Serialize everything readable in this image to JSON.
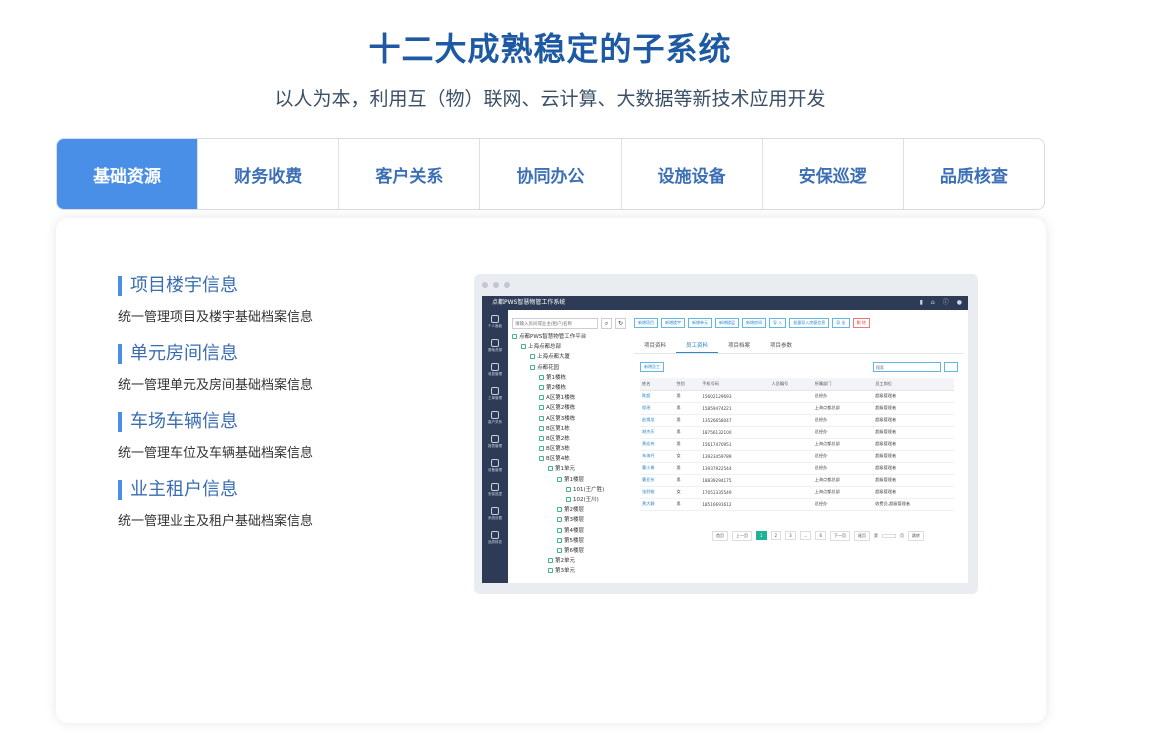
{
  "header": {
    "title": "十二大成熟稳定的子系统",
    "subtitle": "以人为本，利用互（物）联网、云计算、大数据等新技术应用开发"
  },
  "tabs": [
    {
      "label": "基础资源",
      "active": true
    },
    {
      "label": "财务收费",
      "active": false
    },
    {
      "label": "客户关系",
      "active": false
    },
    {
      "label": "协同办公",
      "active": false
    },
    {
      "label": "设施设备",
      "active": false
    },
    {
      "label": "安保巡逻",
      "active": false
    },
    {
      "label": "品质核查",
      "active": false
    }
  ],
  "features": [
    {
      "title": "项目楼宇信息",
      "desc": "统一管理项目及楼宇基础档案信息"
    },
    {
      "title": "单元房间信息",
      "desc": "统一管理单元及房间基础档案信息"
    },
    {
      "title": "车场车辆信息",
      "desc": "统一管理车位及车辆基础档案信息"
    },
    {
      "title": "业主租户信息",
      "desc": "统一管理业主及租户基础档案信息"
    }
  ],
  "colors": {
    "accent": "#4a8fe7",
    "title": "#1d5aa3",
    "app_header": "#2e3b56",
    "pager_active": "#1fb29b"
  },
  "app": {
    "title": "点都PWS智慧物管工作系统",
    "header_icons": [
      "bell-icon",
      "home-icon",
      "info-icon",
      "user-icon"
    ],
    "sidebar": [
      "个人面板",
      "基础资源",
      "收费管理",
      "工单管理",
      "客户关系",
      "报表管理",
      "设备管理",
      "安保巡逻",
      "系统设置",
      "品质核查"
    ],
    "tree_search_placeholder": "请输入房间或业主(租户)名称",
    "tree": [
      "点都PWS智慧物管工作平台",
      "上海点都总部",
      "上海点都大厦",
      "点都花园",
      "第1楼栋",
      "第2楼栋",
      "A区第1楼栋",
      "A区第2楼栋",
      "A区第3楼栋",
      "B区第1栋",
      "B区第2栋",
      "B区第3栋",
      "B区第4栋",
      "第1单元",
      "第1楼层",
      "101(王广胜)",
      "102(王川)",
      "第2楼层",
      "第3楼层",
      "第4楼层",
      "第5楼层",
      "第6楼层",
      "第2单元",
      "第3单元"
    ],
    "toolbar": [
      "新增项目",
      "新增楼宇",
      "新增单元",
      "新增楼层",
      "新增房间",
      "导 入",
      "批量导入房屋信息",
      "导 出",
      "删 除"
    ],
    "subtabs": [
      "项目资料",
      "员工资料",
      "项目档案",
      "项目参数"
    ],
    "active_subtab": 1,
    "add_button": "新增员工",
    "search_placeholder": "搜索",
    "table": {
      "headers": [
        "姓名",
        "性别",
        "手机号码",
        "人员编号",
        "所属部门",
        "员工岗位"
      ],
      "rows": [
        [
          "陈超",
          "男",
          "15602129693",
          "",
          "总经办",
          "超级管理者"
        ],
        [
          "程瑶",
          "男",
          "15859474221",
          "",
          "上海点都总部",
          "超级管理者"
        ],
        [
          "赵焕龙",
          "男",
          "13526658047",
          "",
          "总经办",
          "超级管理者"
        ],
        [
          "胡杰乐",
          "男",
          "18756132100",
          "",
          "总经办",
          "超级管理者"
        ],
        [
          "黄宏伟",
          "男",
          "15617470951",
          "",
          "上海点都总部",
          "超级管理者"
        ],
        [
          "朱海丹",
          "女",
          "13923459789",
          "",
          "总经办",
          "超级管理者"
        ],
        [
          "曹小勇",
          "男",
          "13937922544",
          "",
          "总经办",
          "超级管理者"
        ],
        [
          "曹亚东",
          "男",
          "18839294175",
          "",
          "上海点都总部",
          "超级管理者"
        ],
        [
          "张舒雅",
          "女",
          "17051335549",
          "",
          "上海点都总部",
          "超级管理者"
        ],
        [
          "黄大静",
          "男",
          "18516691612",
          "",
          "总经办",
          "收费员,超级管理者"
        ]
      ]
    },
    "pager": {
      "first": "首页",
      "prev": "上一页",
      "pages": [
        "1",
        "2",
        "3",
        "...",
        "6"
      ],
      "current": "1",
      "next": "下一页",
      "last": "尾页",
      "goto_prefix": "第",
      "goto_suffix": "页",
      "goto_button": "跳转"
    }
  }
}
